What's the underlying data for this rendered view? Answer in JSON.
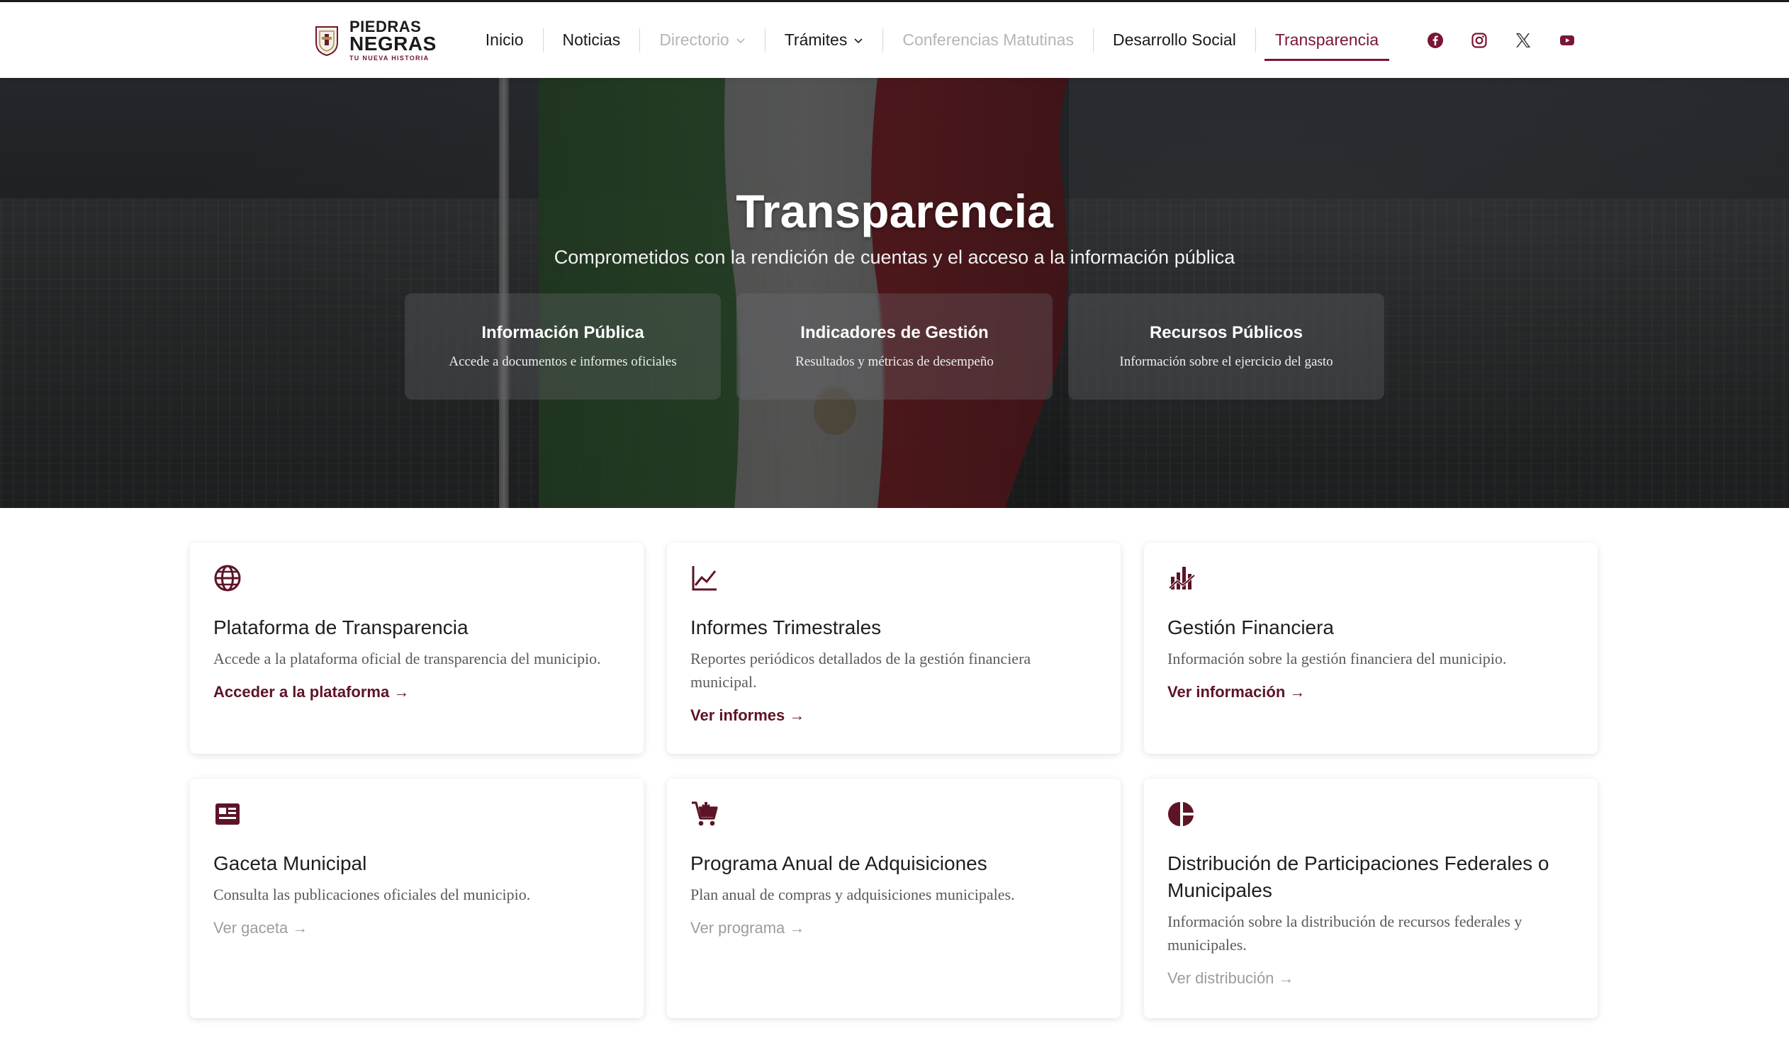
{
  "nav": {
    "logo": {
      "line1": "PIEDRAS",
      "line2": "NEGRAS",
      "tagline": "TU NUEVA HISTORIA"
    },
    "items": [
      {
        "label": "Inicio",
        "state": "normal"
      },
      {
        "label": "Noticias",
        "state": "normal"
      },
      {
        "label": "Directorio",
        "state": "disabled",
        "dropdown": true
      },
      {
        "label": "Trámites",
        "state": "normal",
        "dropdown": true
      },
      {
        "label": "Conferencias Matutinas",
        "state": "disabled"
      },
      {
        "label": "Desarrollo Social",
        "state": "normal"
      },
      {
        "label": "Transparencia",
        "state": "active"
      }
    ],
    "social": [
      "facebook-icon",
      "instagram-icon",
      "x-icon",
      "youtube-icon"
    ],
    "accent_color": "#7a1633"
  },
  "hero": {
    "title": "Transparencia",
    "subtitle": "Comprometidos con la rendición de cuentas y el acceso a la información pública",
    "cards": [
      {
        "title": "Información Pública",
        "desc": "Accede a documentos e informes oficiales"
      },
      {
        "title": "Indicadores de Gestión",
        "desc": "Resultados y métricas de desempeño"
      },
      {
        "title": "Recursos Públicos",
        "desc": "Información sobre el ejercicio del gasto"
      }
    ]
  },
  "cards": [
    {
      "icon": "globe-icon",
      "title": "Plataforma de Transparencia",
      "desc": "Accede a la plataforma oficial de transparencia del municipio.",
      "link": "Acceder a la plataforma →",
      "link_active": true
    },
    {
      "icon": "line-chart-icon",
      "title": "Informes Trimestrales",
      "desc": "Reportes periódicos detallados de la gestión financiera municipal.",
      "link": "Ver informes →",
      "link_active": true
    },
    {
      "icon": "finance-chart-icon",
      "title": "Gestión Financiera",
      "desc": "Información sobre la gestión financiera del municipio.",
      "link": "Ver información →",
      "link_active": true
    },
    {
      "icon": "newspaper-icon",
      "title": "Gaceta Municipal",
      "desc": "Consulta las publicaciones oficiales del municipio.",
      "link": "Ver gaceta →",
      "link_active": false
    },
    {
      "icon": "cart-icon",
      "title": "Programa Anual de Adquisiciones",
      "desc": "Plan anual de compras y adquisiciones municipales.",
      "link": "Ver programa →",
      "link_active": false
    },
    {
      "icon": "pie-chart-icon",
      "title": "Distribución de Participaciones Federales o Municipales",
      "desc": "Información sobre la distribución de recursos federales y municipales.",
      "link": "Ver distribución →",
      "link_active": false
    }
  ]
}
